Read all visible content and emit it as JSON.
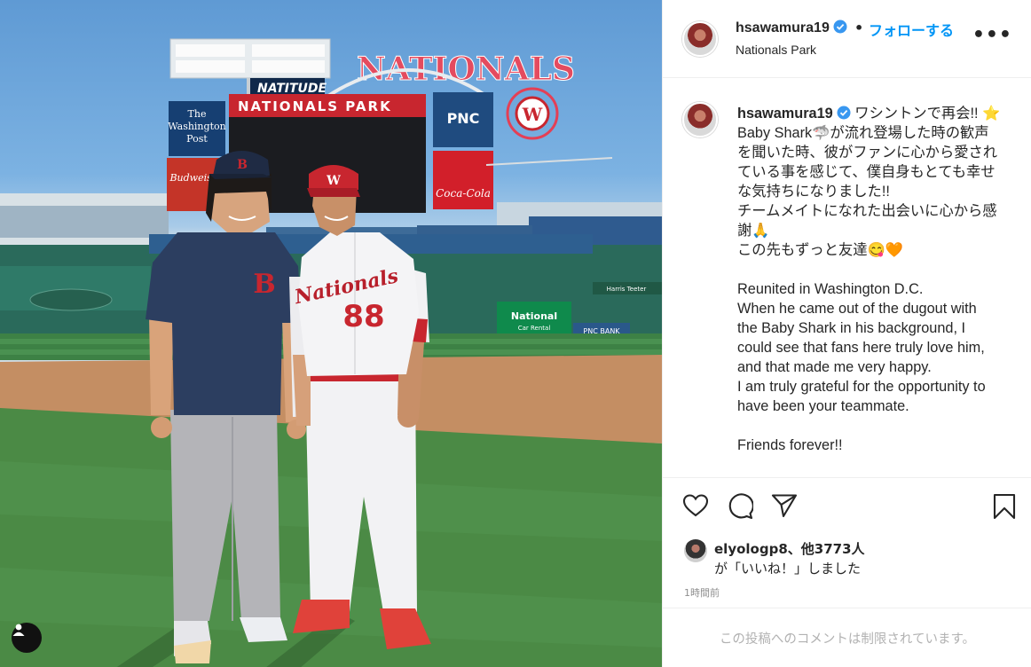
{
  "post": {
    "username": "hsawamura19",
    "follow_label": "フォローする",
    "separator": "•",
    "location": "Nationals Park",
    "more_label": "•••"
  },
  "photo": {
    "scoreboard_brand": "NATIONALS",
    "natitude": "NATITUDE",
    "park_sign": "NATIONALS PARK",
    "wapo_line1": "The",
    "wapo_line2": "Washington",
    "wapo_line3": "Post",
    "pnc": "PNC",
    "budweiser": "Budweiser",
    "coca_cola": "Coca-Cola",
    "national_rental": "National",
    "national_sub": "Car Rental",
    "pnc_bank": "PNC BANK",
    "harris": "Harris Teeter",
    "jersey_name": "Nationals",
    "jersey_number": "88",
    "cap_logo_red_sox": "B",
    "shirt_logo": "B",
    "cap_logo_nats": "W"
  },
  "caption": {
    "lines": [
      "ワシントンで再会!! ⭐",
      "Baby Shark🦈が流れ登場した時の歓声",
      "を聞いた時、彼がファンに心から愛され",
      "ている事を感じて、僕自身もとても幸せ",
      "な気持ちになりました!!",
      "チームメイトになれた出会いに心から感",
      "謝🙏",
      "この先もずっと友達😋🧡"
    ],
    "english_lines": [
      "Reunited in Washington D.C.",
      "When he came out of the dugout with",
      "the Baby Shark in his background, I",
      "could see that fans here truly love him,",
      "and that made me very happy.",
      "I am truly grateful for the opportunity to",
      "have been your teammate."
    ],
    "closing": "Friends forever!!"
  },
  "likes": {
    "liker": "elyologp8",
    "others": "、他3773人",
    "suffix": "が「いいね！」しました"
  },
  "time": "1時間前",
  "comments_disabled": "この投稿へのコメントは制限されています。",
  "colors": {
    "link_blue": "#0095f6",
    "border": "#efefef",
    "muted": "#8e8e8e"
  },
  "icons": [
    "heart-icon",
    "comment-icon",
    "share-icon",
    "bookmark-icon",
    "verified-icon",
    "user-tag-icon"
  ]
}
